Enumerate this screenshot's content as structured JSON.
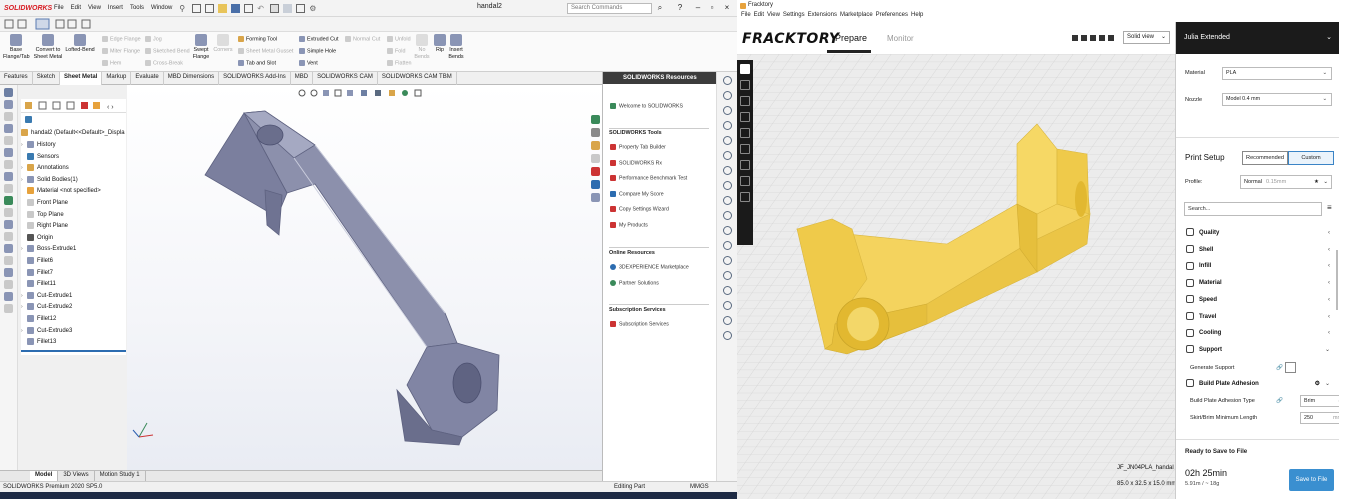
{
  "sw": {
    "logo": "SOLIDWORKS",
    "menus": [
      "File",
      "Edit",
      "View",
      "Insert",
      "Tools",
      "Window"
    ],
    "doc_title": "handal2",
    "search_placeholder": "Search Commands",
    "ribbon": {
      "base_flange": "Base\nFlange/Tab",
      "convert": "Convert to\nSheet Metal",
      "lofted": "Lofted-Bend",
      "edge_flange": "Edge Flange",
      "miter_flange": "Miter Flange",
      "hem": "Hem",
      "jog": "Jog",
      "sketched_bend": "Sketched Bend",
      "cross_break": "Cross-Break",
      "swept_flange": "Swept\nFlange",
      "corners": "Corners",
      "forming_tool": "Forming Tool",
      "sheet_metal_gusset": "Sheet Metal Gusset",
      "tab_and_slot": "Tab and Slot",
      "extruded_cut": "Extruded Cut",
      "simple_hole": "Simple Hole",
      "vent": "Vent",
      "normal_cut": "Normal Cut",
      "unfold": "Unfold",
      "fold": "Fold",
      "flatten": "Flatten",
      "no_bends": "No\nBends",
      "rip": "Rip",
      "insert_bends": "Insert\nBends"
    },
    "tabs": [
      "Features",
      "Sketch",
      "Sheet Metal",
      "Markup",
      "Evaluate",
      "MBD Dimensions",
      "SOLIDWORKS Add-Ins",
      "MBD",
      "SOLIDWORKS CAM",
      "SOLIDWORKS CAM TBM"
    ],
    "tree": {
      "root": "handal2 (Default<<Default>_Displa",
      "items": [
        {
          "label": "History",
          "arrow": "›"
        },
        {
          "label": "Sensors",
          "arrow": ""
        },
        {
          "label": "Annotations",
          "arrow": "›"
        },
        {
          "label": "Solid Bodies(1)",
          "arrow": "›"
        },
        {
          "label": "Material <not specified>",
          "arrow": ""
        },
        {
          "label": "Front Plane",
          "arrow": ""
        },
        {
          "label": "Top Plane",
          "arrow": ""
        },
        {
          "label": "Right Plane",
          "arrow": ""
        },
        {
          "label": "Origin",
          "arrow": ""
        },
        {
          "label": "Boss-Extrude1",
          "arrow": "›"
        },
        {
          "label": "Fillet6",
          "arrow": ""
        },
        {
          "label": "Fillet7",
          "arrow": ""
        },
        {
          "label": "Fillet11",
          "arrow": ""
        },
        {
          "label": "Cut-Extrude1",
          "arrow": "›"
        },
        {
          "label": "Cut-Extrude2",
          "arrow": "›"
        },
        {
          "label": "Fillet12",
          "arrow": ""
        },
        {
          "label": "Cut-Extrude3",
          "arrow": "›"
        },
        {
          "label": "Fillet13",
          "arrow": ""
        }
      ]
    },
    "resources": {
      "title": "SOLIDWORKS Resources",
      "welcome": "Welcome to SOLIDWORKS",
      "tools_title": "SOLIDWORKS Tools",
      "tools": [
        "Property Tab Builder",
        "SOLIDWORKS Rx",
        "Performance Benchmark Test",
        "Compare My Score",
        "Copy Settings Wizard",
        "My Products"
      ],
      "online_title": "Online Resources",
      "online": [
        "3DEXPERIENCE Marketplace",
        "Partner Solutions"
      ],
      "sub_title": "Subscription Services",
      "sub": [
        "Subscription Services"
      ]
    },
    "bottom_tabs": [
      "Model",
      "3D Views",
      "Motion Study 1"
    ],
    "status": {
      "product": "SOLIDWORKS Premium 2020 SP5.0",
      "mode": "Editing Part",
      "units": "MMGS"
    }
  },
  "fk": {
    "window_title": "Fracktory",
    "menus": [
      "File",
      "Edit",
      "View",
      "Settings",
      "Extensions",
      "Marketplace",
      "Preferences",
      "Help"
    ],
    "logo": "FRACKTORY",
    "nav": {
      "prepare": "Prepare",
      "monitor": "Monitor"
    },
    "view_mode": "Solid view",
    "printer": "Julia Extended",
    "material_label": "Material",
    "material_value": "PLA",
    "nozzle_label": "Nozzle",
    "nozzle_value": "Model 0.4 mm",
    "print_setup": "Print Setup",
    "recommended": "Recommended",
    "custom": "Custom",
    "profile_label": "Profile:",
    "profile_value": "Normal",
    "profile_sub": "0.15mm",
    "search_placeholder": "Search...",
    "categories": [
      {
        "label": "Quality",
        "chev": "‹"
      },
      {
        "label": "Shell",
        "chev": "‹"
      },
      {
        "label": "Infill",
        "chev": "‹"
      },
      {
        "label": "Material",
        "chev": "‹"
      },
      {
        "label": "Speed",
        "chev": "‹"
      },
      {
        "label": "Travel",
        "chev": "‹"
      },
      {
        "label": "Cooling",
        "chev": "‹"
      },
      {
        "label": "Support",
        "chev": "⌄"
      }
    ],
    "generate_support": "Generate Support",
    "adhesion_title": "Build Plate Adhesion",
    "adhesion_type_label": "Build Plate Adhesion Type",
    "adhesion_type_value": "Brim",
    "skirt_label": "Skirt/Brim Minimum Length",
    "skirt_value": "250",
    "skirt_unit": "mm",
    "ready": "Ready to Save to File",
    "time": "02h 25min",
    "material_usage": "5.91m / ~ 18g",
    "save_button": "Save to File",
    "object_name": "JF_JN04PLA_handal",
    "object_dims": "85.0 x 32.5 x 15.0 mm"
  },
  "colors": {
    "sw_red": "#d71920",
    "part_gray": "#7d82a3",
    "part_yellow": "#f2d15a",
    "fk_blue": "#3a8fd0",
    "dark": "#1b1b1b"
  }
}
